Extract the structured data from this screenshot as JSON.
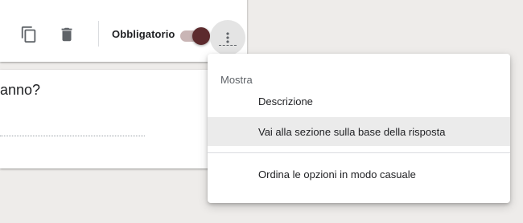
{
  "toolbar": {
    "required_label": "Obbligatorio",
    "required_enabled": true,
    "accent_color": "#5c2a2d",
    "icons": [
      "copy-icon",
      "delete-icon",
      "more-vert-icon"
    ]
  },
  "question": {
    "text_fragment": "anno?"
  },
  "menu": {
    "header": "Mostra",
    "items": [
      {
        "label": "Descrizione",
        "highlighted": false
      },
      {
        "label": "Vai alla sezione sulla base della risposta",
        "highlighted": true
      },
      {
        "label": "Ordina le opzioni in modo casuale",
        "highlighted": false
      }
    ]
  }
}
